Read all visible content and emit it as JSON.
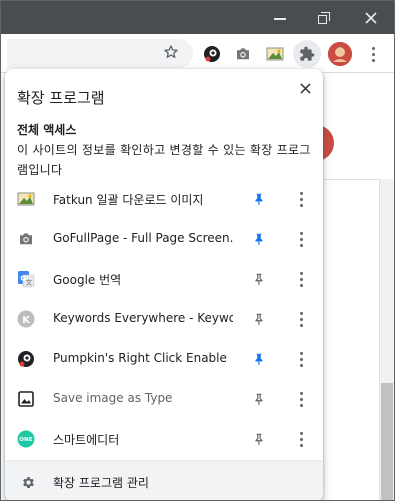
{
  "popup": {
    "title": "확장 프로그램",
    "access_title": "전체 액세스",
    "access_desc": "이 사이트의 정보를 확인하고 변경할 수 있는 확장 프로그램입니다",
    "extensions": [
      {
        "name": "Fatkun 일괄 다운로드 이미지",
        "icon": "fatkun-icon",
        "pinned": true
      },
      {
        "name": "GoFullPage - Full Page Screen...",
        "icon": "camera-icon",
        "pinned": true
      },
      {
        "name": "Google 번역",
        "icon": "google-translate-icon",
        "pinned": false
      },
      {
        "name": "Keywords Everywhere - Keywo...",
        "icon": "keywords-everywhere-icon",
        "pinned": false
      },
      {
        "name": "Pumpkin's Right Click Enable",
        "icon": "pumpkin-icon",
        "pinned": true
      },
      {
        "name": "Save image as Type",
        "icon": "image-icon",
        "pinned": false
      },
      {
        "name": "스마트에디터",
        "icon": "smarteditor-icon",
        "pinned": false
      }
    ],
    "manage_label": "확장 프로그램 관리"
  },
  "colors": {
    "titlebar": "#494d52",
    "pin_active": "#1a73e8",
    "pin_inactive": "#5f6368",
    "avatar": "#c94b42"
  }
}
